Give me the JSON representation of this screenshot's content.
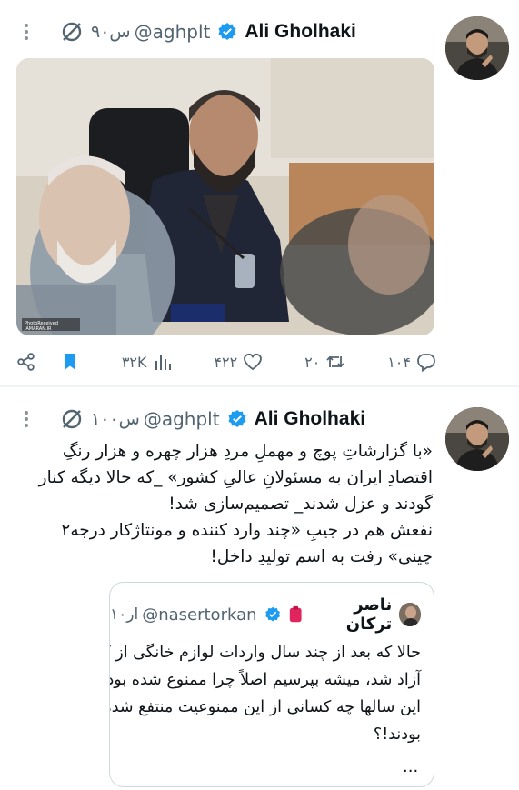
{
  "tweet1": {
    "author_name": "Ali Gholhaki",
    "handle": "@aghplt",
    "time": "۹۰س",
    "image_watermark": "PhotoReceived JAMARAN.IR",
    "stats": {
      "views": "۳۲K",
      "likes": "۴۲۲",
      "retweets": "۲۰",
      "replies": "۱۰۴"
    }
  },
  "tweet2": {
    "author_name": "Ali Gholhaki",
    "handle": "@aghplt",
    "time": "۱۰۰س",
    "text_lines": [
      "«با گزارشاتِ پوچ و مهملِ مردِ هزار چهره و هزار رنگِ",
      "اقتصادِ ایران به مسئولانِ عالیِ کشور» _که حالا دیگه کنار",
      "گودند و عزل شدند_ تصمیم‌سازی شد!",
      "نفعش هم در جیبِ «چند وارد کننده و مونتاژکار درجه۲",
      "چینی» رفت به اسم تولیدِ داخل!"
    ],
    "quote": {
      "name": "ناصر ترکان",
      "handle": "@nasertorkan",
      "time": "۱۰ار",
      "text_lines": [
        "حالا که بعد از چند سال واردات لوازم خانگی از کره",
        "آزاد شد، میشه بپرسیم اصلاً چرا ممنوع شده بود و در",
        "این سالها چه کسانی از این ممنوعیت منتفع شده",
        "بودند!؟"
      ],
      "more": "..."
    }
  },
  "colors": {
    "verified": "#1d9bf0",
    "bookmark": "#1d9bf0",
    "muted": "#536471",
    "border": "#cfd9de"
  }
}
